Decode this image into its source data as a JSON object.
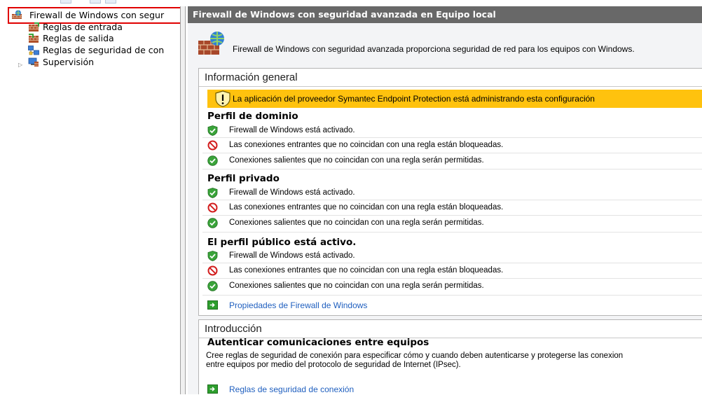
{
  "tree": {
    "root": {
      "label": "Firewall de Windows con segur",
      "icon": "firewall-icon"
    },
    "items": [
      {
        "label": "Reglas de entrada",
        "icon": "inbound-rules-icon"
      },
      {
        "label": "Reglas de salida",
        "icon": "outbound-rules-icon"
      },
      {
        "label": "Reglas de seguridad de con",
        "icon": "connection-security-icon"
      },
      {
        "label": "Supervisión",
        "icon": "monitor-icon",
        "expander": "▷"
      }
    ]
  },
  "header": {
    "title": "Firewall de Windows con seguridad avanzada en Equipo local"
  },
  "hero": {
    "text": "Firewall de Windows con seguridad avanzada proporciona seguridad de red para los equipos con Windows."
  },
  "overview": {
    "title": "Información general",
    "warning": "La aplicación del proveedor Symantec Endpoint Protection está administrando esta configuración",
    "profiles": [
      {
        "title": "Perfil de dominio",
        "rows": [
          {
            "icon": "check-shield-icon",
            "text": "Firewall de Windows está activado."
          },
          {
            "icon": "block-icon",
            "text": "Las conexiones entrantes que no coincidan con una regla están bloqueadas."
          },
          {
            "icon": "allow-icon",
            "text": "Conexiones salientes que no coincidan con una regla serán permitidas."
          }
        ]
      },
      {
        "title": "Perfil privado",
        "rows": [
          {
            "icon": "check-shield-icon",
            "text": "Firewall de Windows está activado."
          },
          {
            "icon": "block-icon",
            "text": "Las conexiones entrantes que no coincidan con una regla están bloqueadas."
          },
          {
            "icon": "allow-icon",
            "text": "Conexiones salientes que no coincidan con una regla serán permitidas."
          }
        ]
      },
      {
        "title": "El perfil público está activo.",
        "rows": [
          {
            "icon": "check-shield-icon",
            "text": "Firewall de Windows está activado."
          },
          {
            "icon": "block-icon",
            "text": "Las conexiones entrantes que no coincidan con una regla están bloqueadas."
          },
          {
            "icon": "allow-icon",
            "text": "Conexiones salientes que no coincidan con una regla serán permitidas."
          }
        ]
      }
    ],
    "link": "Propiedades de Firewall de Windows"
  },
  "intro": {
    "title": "Introducción",
    "heading": "Autenticar comunicaciones entre equipos",
    "line1": "Cree reglas de seguridad de conexión para especificar cómo y cuando deben autenticarse y protegerse las conexion",
    "line2": "entre equipos por medio del protocolo de seguridad de Internet (IPsec).",
    "link": "Reglas de seguridad de conexión"
  },
  "colors": {
    "header_bg": "#686868",
    "warning_bg": "#ffc20e",
    "link": "#1f5fbf",
    "selection_highlight": "#e00000",
    "check_green": "#3aa43a",
    "block_red": "#d32020"
  }
}
